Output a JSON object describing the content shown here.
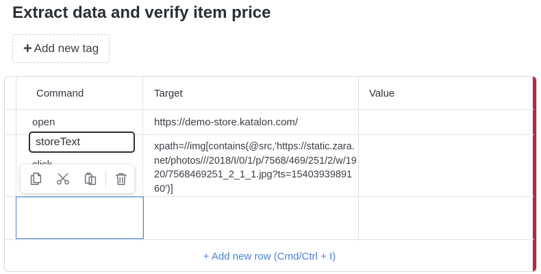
{
  "page": {
    "title": "Extract data and verify item price",
    "add_tag_label": "Add new tag"
  },
  "table": {
    "headers": [
      "Command",
      "Target",
      "Value"
    ],
    "rows": [
      {
        "command": "open",
        "target": "https://demo-store.katalon.com/",
        "value": ""
      },
      {
        "command": "click",
        "target": "xpath=//img[contains(@src,'https://static.zara.net/photos///2018/I/0/1/p/7568/469/251/2/w/1920/7568469251_2_1_1.jpg?ts=1540393989160')]",
        "value": ""
      },
      {
        "command": "storeText",
        "target": "",
        "value": ""
      }
    ],
    "add_row_label": "+ Add new row (Cmd/Ctrl + I)"
  },
  "toolbar": {
    "icons": [
      "copy-icon",
      "cut-icon",
      "paste-icon",
      "delete-icon"
    ]
  },
  "colors": {
    "accent": "#b5293f",
    "link": "#4a7fd4",
    "selection": "#4a7fd4"
  }
}
